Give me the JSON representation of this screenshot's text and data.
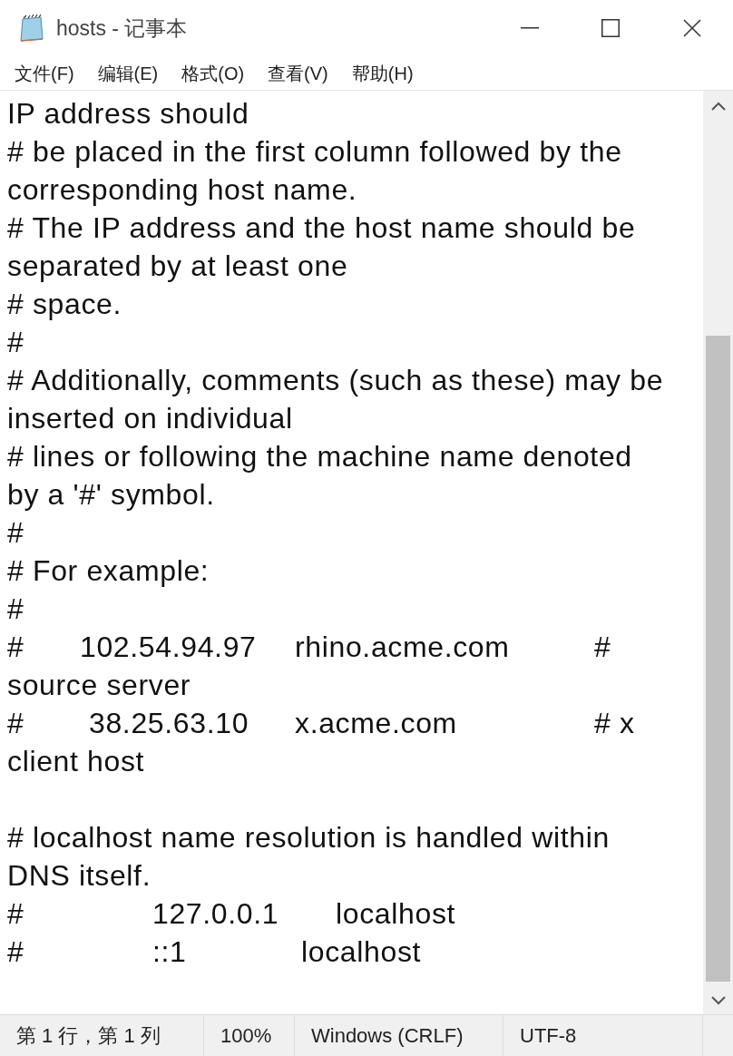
{
  "window": {
    "title": "hosts - 记事本"
  },
  "menu": [
    "文件(F)",
    "编辑(E)",
    "格式(O)",
    "查看(V)",
    "帮助(H)"
  ],
  "lines": [
    {
      "kind": "text",
      "text": "IP address should"
    },
    {
      "kind": "text",
      "text": "# be placed in the first column followed by the"
    },
    {
      "kind": "text",
      "text": "corresponding host name."
    },
    {
      "kind": "text",
      "text": "# The IP address and the host name should be"
    },
    {
      "kind": "text",
      "text": "separated by at least one"
    },
    {
      "kind": "text",
      "text": "# space."
    },
    {
      "kind": "text",
      "text": "#"
    },
    {
      "kind": "text",
      "text": "# Additionally, comments (such as these) may be"
    },
    {
      "kind": "text",
      "text": "inserted on individual"
    },
    {
      "kind": "text",
      "text": "# lines or following the machine name denoted"
    },
    {
      "kind": "text",
      "text": "by a '#' symbol."
    },
    {
      "kind": "text",
      "text": "#"
    },
    {
      "kind": "text",
      "text": "# For example:"
    },
    {
      "kind": "text",
      "text": "#"
    },
    {
      "kind": "entry",
      "segments": [
        "#",
        "102.54.94.97",
        "rhino.acme.com",
        "#"
      ]
    },
    {
      "kind": "text",
      "text": "source server"
    },
    {
      "kind": "entry",
      "segments": [
        "#",
        "38.25.63.10",
        "x.acme.com",
        "# x"
      ]
    },
    {
      "kind": "text",
      "text": "client host"
    },
    {
      "kind": "blank"
    },
    {
      "kind": "text",
      "text": "# localhost name resolution is handled within"
    },
    {
      "kind": "text",
      "text": "DNS itself."
    },
    {
      "kind": "local",
      "segments": [
        "#",
        "127.0.0.1",
        "localhost"
      ]
    },
    {
      "kind": "local",
      "segments": [
        "#",
        "::1",
        "localhost"
      ]
    }
  ],
  "status_bar": [
    "第 1 行，第 1 列",
    "100%",
    "Windows (CRLF)",
    "UTF-8"
  ]
}
